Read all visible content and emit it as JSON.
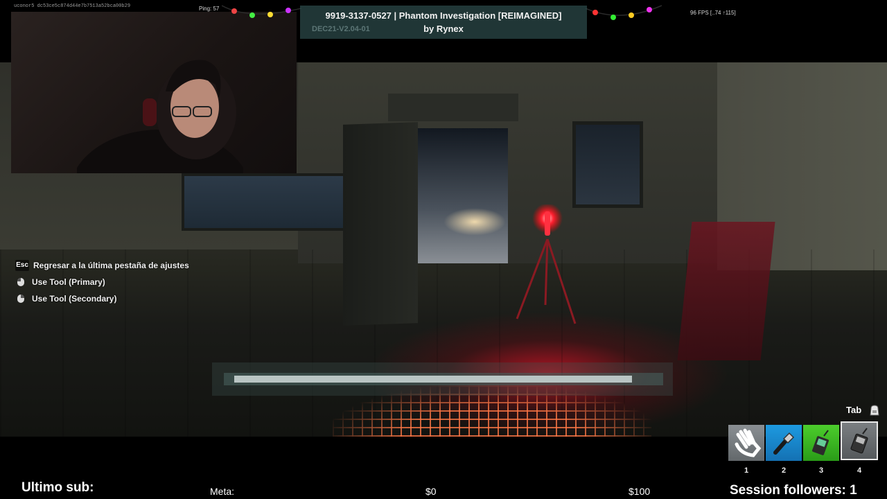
{
  "stream": {
    "webcam_label": "webcam",
    "footer": {
      "last_sub_label": "Ultimo sub:",
      "goal_label": "Meta:",
      "goal_current": "$0",
      "goal_target": "$100",
      "session_followers": "Session followers: 1"
    }
  },
  "hud": {
    "id_text": "uconor5   dc53ce5c874d44e7b7513a52bca00b29",
    "ping": "Ping: 57",
    "fps": "96 FPS [..74 ↑115]",
    "island_title": "9919-3137-0527 | Phantom Investigation [REIMAGINED]",
    "island_author": "by Rynex",
    "island_version": "DEC21-V2.04-01"
  },
  "hints": [
    {
      "key": "Esc",
      "label": "Regresar a la última pestaña de ajustes"
    },
    {
      "key": "mouse-left",
      "label": "Use Tool (Primary)"
    },
    {
      "key": "mouse-right",
      "label": "Use Tool (Secondary)"
    }
  ],
  "progress": {
    "value": 0.95
  },
  "toolbar": {
    "tab_key": "Tab",
    "slots": [
      {
        "number": "1",
        "icon": "hand-icon",
        "color": "#8a8f93"
      },
      {
        "number": "2",
        "icon": "flashlight-icon",
        "color": "#1d9ae0"
      },
      {
        "number": "3",
        "icon": "emf-reader-icon",
        "color": "#4ccd2c"
      },
      {
        "number": "4",
        "icon": "spirit-box-icon",
        "color": "#7b7f82",
        "selected": true
      }
    ]
  },
  "colors": {
    "accent_red": "#e01428",
    "title_panel": "#2d4b4b"
  }
}
